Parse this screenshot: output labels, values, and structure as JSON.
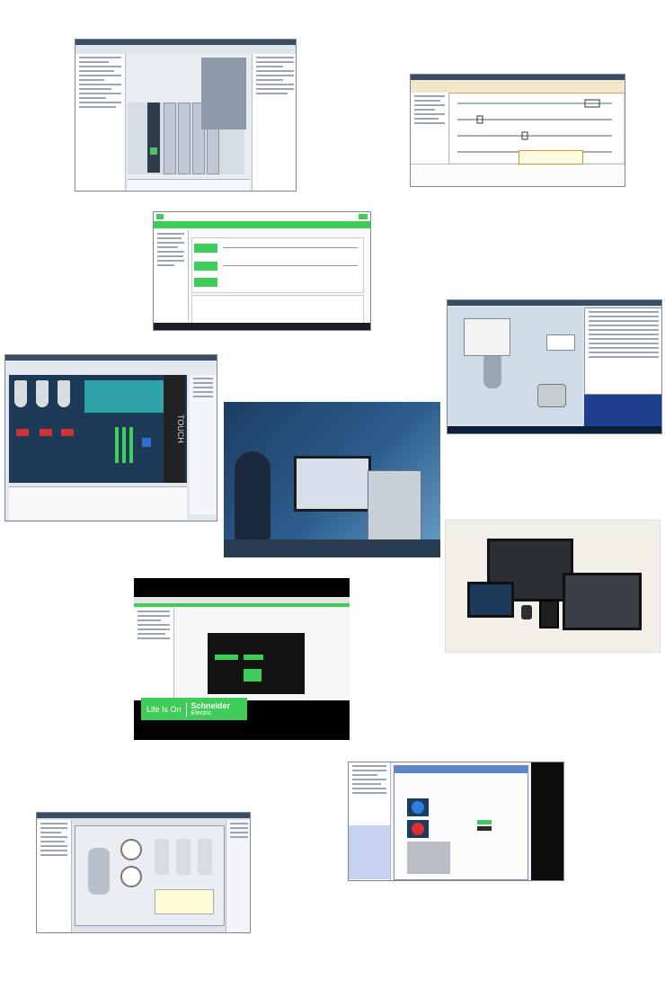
{
  "touch_panel": {
    "label": "TOUCH"
  },
  "schneider": {
    "tagline": "Life Is On",
    "brand": "Schneider",
    "sub": "Electric"
  }
}
